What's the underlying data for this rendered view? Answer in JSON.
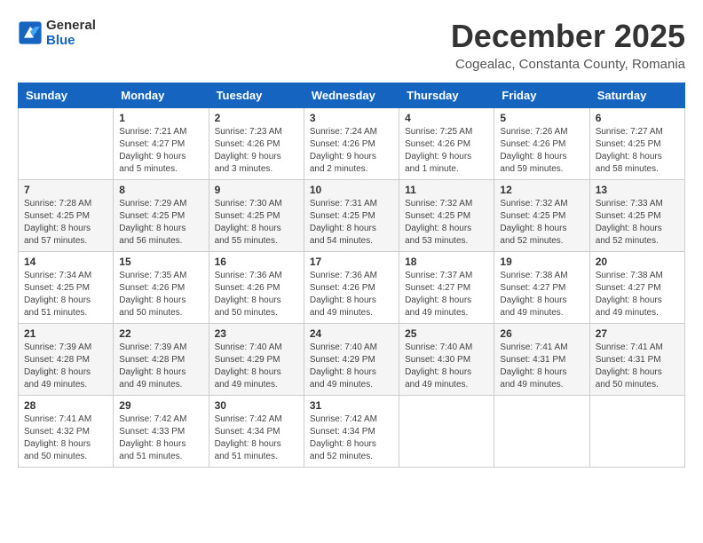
{
  "header": {
    "logo_line1": "General",
    "logo_line2": "Blue",
    "month_title": "December 2025",
    "subtitle": "Cogealac, Constanta County, Romania"
  },
  "weekdays": [
    "Sunday",
    "Monday",
    "Tuesday",
    "Wednesday",
    "Thursday",
    "Friday",
    "Saturday"
  ],
  "weeks": [
    [
      {
        "day": "",
        "info": ""
      },
      {
        "day": "1",
        "info": "Sunrise: 7:21 AM\nSunset: 4:27 PM\nDaylight: 9 hours\nand 5 minutes."
      },
      {
        "day": "2",
        "info": "Sunrise: 7:23 AM\nSunset: 4:26 PM\nDaylight: 9 hours\nand 3 minutes."
      },
      {
        "day": "3",
        "info": "Sunrise: 7:24 AM\nSunset: 4:26 PM\nDaylight: 9 hours\nand 2 minutes."
      },
      {
        "day": "4",
        "info": "Sunrise: 7:25 AM\nSunset: 4:26 PM\nDaylight: 9 hours\nand 1 minute."
      },
      {
        "day": "5",
        "info": "Sunrise: 7:26 AM\nSunset: 4:26 PM\nDaylight: 8 hours\nand 59 minutes."
      },
      {
        "day": "6",
        "info": "Sunrise: 7:27 AM\nSunset: 4:25 PM\nDaylight: 8 hours\nand 58 minutes."
      }
    ],
    [
      {
        "day": "7",
        "info": "Sunrise: 7:28 AM\nSunset: 4:25 PM\nDaylight: 8 hours\nand 57 minutes."
      },
      {
        "day": "8",
        "info": "Sunrise: 7:29 AM\nSunset: 4:25 PM\nDaylight: 8 hours\nand 56 minutes."
      },
      {
        "day": "9",
        "info": "Sunrise: 7:30 AM\nSunset: 4:25 PM\nDaylight: 8 hours\nand 55 minutes."
      },
      {
        "day": "10",
        "info": "Sunrise: 7:31 AM\nSunset: 4:25 PM\nDaylight: 8 hours\nand 54 minutes."
      },
      {
        "day": "11",
        "info": "Sunrise: 7:32 AM\nSunset: 4:25 PM\nDaylight: 8 hours\nand 53 minutes."
      },
      {
        "day": "12",
        "info": "Sunrise: 7:32 AM\nSunset: 4:25 PM\nDaylight: 8 hours\nand 52 minutes."
      },
      {
        "day": "13",
        "info": "Sunrise: 7:33 AM\nSunset: 4:25 PM\nDaylight: 8 hours\nand 52 minutes."
      }
    ],
    [
      {
        "day": "14",
        "info": "Sunrise: 7:34 AM\nSunset: 4:25 PM\nDaylight: 8 hours\nand 51 minutes."
      },
      {
        "day": "15",
        "info": "Sunrise: 7:35 AM\nSunset: 4:26 PM\nDaylight: 8 hours\nand 50 minutes."
      },
      {
        "day": "16",
        "info": "Sunrise: 7:36 AM\nSunset: 4:26 PM\nDaylight: 8 hours\nand 50 minutes."
      },
      {
        "day": "17",
        "info": "Sunrise: 7:36 AM\nSunset: 4:26 PM\nDaylight: 8 hours\nand 49 minutes."
      },
      {
        "day": "18",
        "info": "Sunrise: 7:37 AM\nSunset: 4:27 PM\nDaylight: 8 hours\nand 49 minutes."
      },
      {
        "day": "19",
        "info": "Sunrise: 7:38 AM\nSunset: 4:27 PM\nDaylight: 8 hours\nand 49 minutes."
      },
      {
        "day": "20",
        "info": "Sunrise: 7:38 AM\nSunset: 4:27 PM\nDaylight: 8 hours\nand 49 minutes."
      }
    ],
    [
      {
        "day": "21",
        "info": "Sunrise: 7:39 AM\nSunset: 4:28 PM\nDaylight: 8 hours\nand 49 minutes."
      },
      {
        "day": "22",
        "info": "Sunrise: 7:39 AM\nSunset: 4:28 PM\nDaylight: 8 hours\nand 49 minutes."
      },
      {
        "day": "23",
        "info": "Sunrise: 7:40 AM\nSunset: 4:29 PM\nDaylight: 8 hours\nand 49 minutes."
      },
      {
        "day": "24",
        "info": "Sunrise: 7:40 AM\nSunset: 4:29 PM\nDaylight: 8 hours\nand 49 minutes."
      },
      {
        "day": "25",
        "info": "Sunrise: 7:40 AM\nSunset: 4:30 PM\nDaylight: 8 hours\nand 49 minutes."
      },
      {
        "day": "26",
        "info": "Sunrise: 7:41 AM\nSunset: 4:31 PM\nDaylight: 8 hours\nand 49 minutes."
      },
      {
        "day": "27",
        "info": "Sunrise: 7:41 AM\nSunset: 4:31 PM\nDaylight: 8 hours\nand 50 minutes."
      }
    ],
    [
      {
        "day": "28",
        "info": "Sunrise: 7:41 AM\nSunset: 4:32 PM\nDaylight: 8 hours\nand 50 minutes."
      },
      {
        "day": "29",
        "info": "Sunrise: 7:42 AM\nSunset: 4:33 PM\nDaylight: 8 hours\nand 51 minutes."
      },
      {
        "day": "30",
        "info": "Sunrise: 7:42 AM\nSunset: 4:34 PM\nDaylight: 8 hours\nand 51 minutes."
      },
      {
        "day": "31",
        "info": "Sunrise: 7:42 AM\nSunset: 4:34 PM\nDaylight: 8 hours\nand 52 minutes."
      },
      {
        "day": "",
        "info": ""
      },
      {
        "day": "",
        "info": ""
      },
      {
        "day": "",
        "info": ""
      }
    ]
  ]
}
